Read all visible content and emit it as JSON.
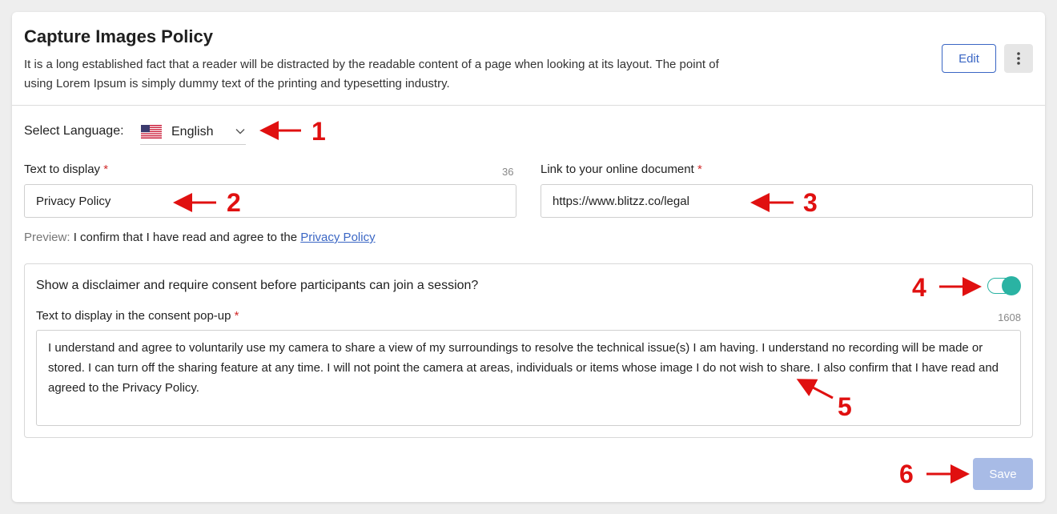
{
  "header": {
    "title": "Capture Images Policy",
    "description": "It is a long established fact that a reader will be distracted by the readable content of a page when looking at its layout. The point of using Lorem Ipsum is simply dummy text of the printing and typesetting industry.",
    "edit_label": "Edit",
    "more_icon": "more-vertical-icon"
  },
  "language": {
    "label": "Select Language:",
    "value": "English",
    "flag_icon": "us-flag-icon",
    "chevron_icon": "chevron-down-icon"
  },
  "text_to_display": {
    "label": "Text to display",
    "required_mark": "*",
    "count": "36",
    "value": "Privacy Policy"
  },
  "document_link": {
    "label": "Link to your online document",
    "required_mark": "*",
    "value": "https://www.blitzz.co/legal"
  },
  "preview": {
    "label": "Preview:",
    "text": "I confirm that I have read and agree to the",
    "link_text": "Privacy Policy"
  },
  "disclaimer": {
    "question": "Show a disclaimer and require consent before participants can join a session?",
    "enabled": true,
    "consent_label": "Text to display in the consent pop-up",
    "required_mark": "*",
    "consent_count": "1608",
    "consent_text": "I understand and agree to voluntarily use my camera to share a view of my surroundings to resolve the technical issue(s) I am having. I understand no recording will be made or stored. I can turn off the sharing feature at any time. I will not point the camera at areas, individuals or items whose image I do not wish to share. I also confirm that I have read and agreed to the Privacy Policy."
  },
  "footer": {
    "save_label": "Save"
  },
  "annotations": {
    "numbers": [
      "1",
      "2",
      "3",
      "4",
      "5",
      "6"
    ],
    "color": "#e01010"
  },
  "colors": {
    "accent": "#3a66c4",
    "toggle_on": "#2ab3a3",
    "save_disabled": "#a8bbe6",
    "required": "#d12b2b"
  }
}
